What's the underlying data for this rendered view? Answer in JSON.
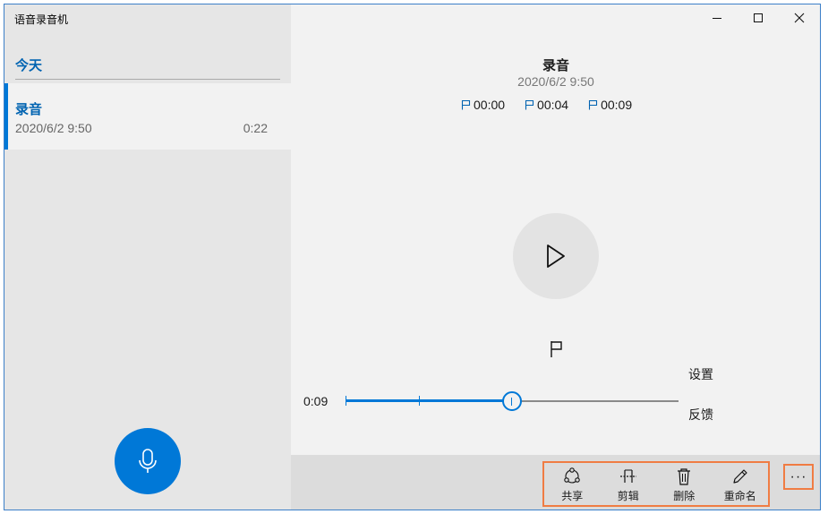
{
  "app": {
    "title": "语音录音机"
  },
  "sidebar": {
    "group_header": "今天",
    "recordings": [
      {
        "name": "录音",
        "date": "2020/6/2 9:50",
        "duration": "0:22"
      }
    ]
  },
  "main": {
    "title": "录音",
    "date": "2020/6/2 9:50",
    "markers": [
      "00:00",
      "00:04",
      "00:09"
    ]
  },
  "player": {
    "current_time": "0:09",
    "progress_fraction": 0.5,
    "marker_fractions": [
      0.0,
      0.22
    ]
  },
  "menu": {
    "settings": "设置",
    "feedback": "反馈"
  },
  "commands": {
    "share": "共享",
    "trim": "剪辑",
    "delete": "删除",
    "rename": "重命名",
    "more": "···"
  },
  "colors": {
    "accent": "#0078d7",
    "highlight": "#f07c43"
  }
}
